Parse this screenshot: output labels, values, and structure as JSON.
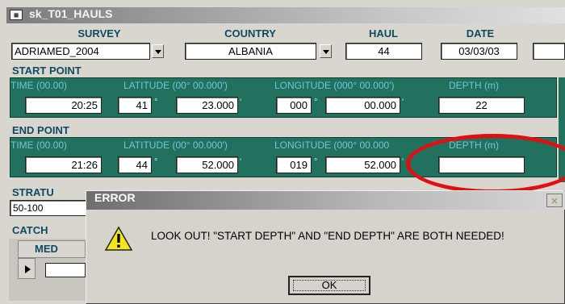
{
  "window": {
    "title": "sk_T01_HAULS",
    "icon": "form-icon"
  },
  "header": {
    "survey": {
      "label": "SURVEY",
      "value": "ADRIAMED_2004"
    },
    "country": {
      "label": "COUNTRY",
      "value": "ALBANIA"
    },
    "haul": {
      "label": "HAUL",
      "value": "44"
    },
    "date": {
      "label": "DATE",
      "value": "03/03/03"
    }
  },
  "start_point": {
    "title": "START POINT",
    "labels": {
      "time": "TIME (00.00)",
      "latitude": "LATITUDE (00° 00.000')",
      "longitude": "LONGITUDE (000° 00.000')",
      "depth": "DEPTH (m)"
    },
    "time": "20:25",
    "lat_deg": "41",
    "lat_min": "23.000",
    "lon_deg": "000",
    "lon_min": "00.000",
    "depth": "22"
  },
  "end_point": {
    "title": "END POINT",
    "labels": {
      "time": "TIME (00.00)",
      "latitude": "LATITUDE (00° 00.000')",
      "longitude": "LONGITUDE (000° 00.000",
      "depth": "DEPTH (m)"
    },
    "time": "21:26",
    "lat_deg": "44",
    "lat_min": "52.000",
    "lon_deg": "019",
    "lon_min": "52.000",
    "depth": ""
  },
  "units": {
    "deg": "°",
    "min": "'"
  },
  "stratum": {
    "label": "STRATU",
    "value": "50-100"
  },
  "catch": {
    "label": "CATCH",
    "column": "MED"
  },
  "dialog": {
    "title": "ERROR",
    "close": "×",
    "message": "LOOK OUT! \"START DEPTH\" AND \"END DEPTH\" ARE BOTH NEEDED!",
    "ok": "OK",
    "icon": "warning-icon"
  },
  "colors": {
    "panel": "#22705e",
    "panel_label": "#6fc7d9",
    "header_text": "#0f4a63",
    "highlight": "#e01010"
  }
}
